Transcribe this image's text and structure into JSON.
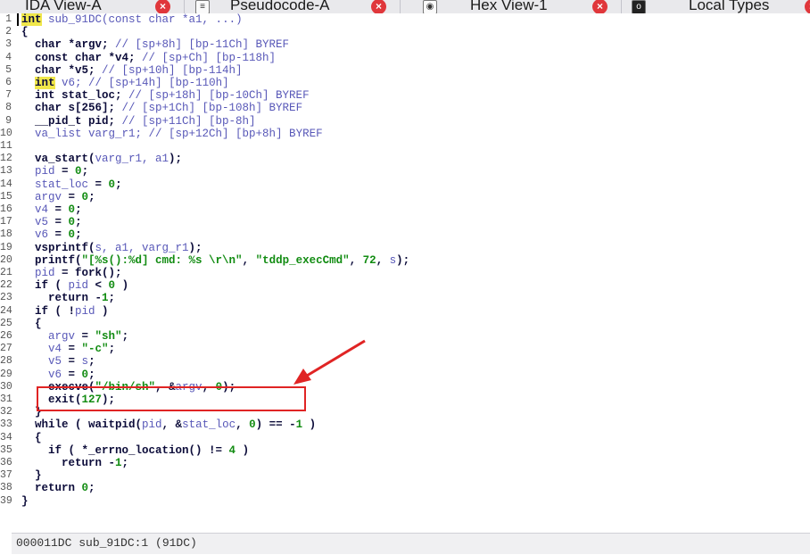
{
  "tabs": [
    {
      "label": "IDA View-A",
      "closable": true
    },
    {
      "label": "Pseudocode-A",
      "closable": true,
      "active": true
    },
    {
      "label": "Hex View-1",
      "closable": true
    },
    {
      "label": "Local Types",
      "closable": true
    }
  ],
  "code_lines": [
    {
      "n": "1",
      "html": "<span class=\"ty-hl\">int</span> <span class=\"var\">sub_91DC(const char *a1, ...)</span>"
    },
    {
      "n": "2",
      "html": "{"
    },
    {
      "n": "3",
      "html": "  char *argv; <span class=\"cmt\">// [sp+8h] [bp-11Ch] BYREF</span>"
    },
    {
      "n": "4",
      "html": "  const char *v4; <span class=\"cmt\">// [sp+Ch] [bp-118h]</span>"
    },
    {
      "n": "5",
      "html": "  char *v5; <span class=\"cmt\">// [sp+10h] [bp-114h]</span>"
    },
    {
      "n": "6",
      "html": "  <span class=\"ty-hl\">int</span> <span class=\"var\">v6; // [sp+14h] [bp-110h]</span>"
    },
    {
      "n": "7",
      "html": "  int stat_loc; <span class=\"cmt\">// [sp+18h] [bp-10Ch] BYREF</span>"
    },
    {
      "n": "8",
      "html": "  char s[256]; <span class=\"cmt\">// [sp+1Ch] [bp-108h] BYREF</span>"
    },
    {
      "n": "9",
      "html": "  __pid_t pid; <span class=\"cmt\">// [sp+11Ch] [bp-8h]</span>"
    },
    {
      "n": "10",
      "html": "  <span class=\"var\">va_list varg_r1; // [sp+12Ch] [bp+8h] BYREF</span>"
    },
    {
      "n": "11",
      "html": ""
    },
    {
      "n": "12",
      "html": "  va_start(<span class=\"var\">varg_r1, a1</span>);"
    },
    {
      "n": "13",
      "html": "  <span class=\"var\">pid</span> = <span class=\"num\">0</span>;"
    },
    {
      "n": "14",
      "html": "  <span class=\"var\">stat_loc</span> = <span class=\"num\">0</span>;"
    },
    {
      "n": "15",
      "html": "  <span class=\"var\">argv</span> = <span class=\"num\">0</span>;"
    },
    {
      "n": "16",
      "html": "  <span class=\"var\">v4</span> = <span class=\"num\">0</span>;"
    },
    {
      "n": "17",
      "html": "  <span class=\"var\">v5</span> = <span class=\"num\">0</span>;"
    },
    {
      "n": "18",
      "html": "  <span class=\"var\">v6</span> = <span class=\"num\">0</span>;"
    },
    {
      "n": "19",
      "html": "  vsprintf(<span class=\"var\">s, a1, varg_r1</span>);"
    },
    {
      "n": "20",
      "html": "  printf(<span class=\"str\">\"[%s():%d] cmd: %s \\r\\n\"</span>, <span class=\"str\">\"tddp_execCmd\"</span>, <span class=\"num\">72</span>, <span class=\"var\">s</span>);"
    },
    {
      "n": "21",
      "html": "  <span class=\"var\">pid</span> = fork();"
    },
    {
      "n": "22",
      "html": "  if ( <span class=\"var\">pid</span> &lt; <span class=\"num\">0</span> )"
    },
    {
      "n": "23",
      "html": "    return -<span class=\"num\">1</span>;"
    },
    {
      "n": "24",
      "html": "  if ( !<span class=\"var\">pid</span> )"
    },
    {
      "n": "25",
      "html": "  {"
    },
    {
      "n": "26",
      "html": "    <span class=\"var\">argv</span> = <span class=\"str\">\"sh\"</span>;"
    },
    {
      "n": "27",
      "html": "    <span class=\"var\">v4</span> = <span class=\"str\">\"-c\"</span>;"
    },
    {
      "n": "28",
      "html": "    <span class=\"var\">v5</span> = <span class=\"var\">s</span>;"
    },
    {
      "n": "29",
      "html": "    <span class=\"var\">v6</span> = <span class=\"num\">0</span>;"
    },
    {
      "n": "30",
      "html": "    execve(<span class=\"str\">\"/bin/sh\"</span>, &amp;<span class=\"var\">argv</span>, <span class=\"num\">0</span>);"
    },
    {
      "n": "31",
      "html": "    exit(<span class=\"num\">127</span>);"
    },
    {
      "n": "32",
      "html": "  }"
    },
    {
      "n": "33",
      "html": "  while ( waitpid(<span class=\"var\">pid</span>, &amp;<span class=\"var\">stat_loc</span>, <span class=\"num\">0</span>) == -<span class=\"num\">1</span> )"
    },
    {
      "n": "34",
      "html": "  {"
    },
    {
      "n": "35",
      "html": "    if ( *_errno_location() != <span class=\"num\">4</span> )"
    },
    {
      "n": "36",
      "html": "      return -<span class=\"num\">1</span>;"
    },
    {
      "n": "37",
      "html": "  }"
    },
    {
      "n": "38",
      "html": "  return <span class=\"num\">0</span>;"
    },
    {
      "n": "39",
      "html": "}"
    }
  ],
  "status": {
    "text": "000011DC sub_91DC:1 (91DC)"
  },
  "colors": {
    "annotation": "#e02424",
    "highlight": "#f0e74a",
    "close_badge": "#e0373b"
  }
}
